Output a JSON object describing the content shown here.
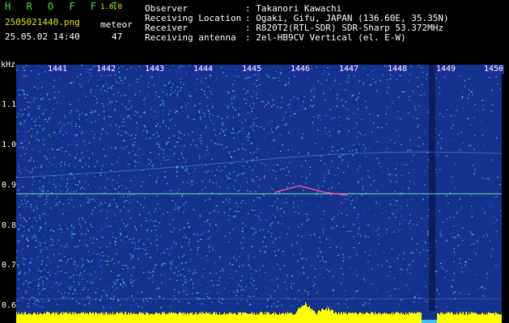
{
  "header": {
    "app_title": "H R O F F T",
    "app_version": "1.0.0",
    "file_name": "2505021440.png",
    "timestamp": "25.05.02 14:40",
    "meteor_label": "meteor",
    "meteor_count": "47"
  },
  "station_info": [
    {
      "label": "Observer",
      "value": ": Takanori Kawachi"
    },
    {
      "label": "Receiving Location",
      "value": ": Ogaki, Gifu, JAPAN (136.60E, 35.35N)"
    },
    {
      "label": "Receiver",
      "value": ": R820T2(RTL-SDR) SDR-Sharp 53.372MHz"
    },
    {
      "label": "Receiving antenna",
      "value": ": 2el-HB9CV Vertical (el. E-W)"
    }
  ],
  "spectrogram": {
    "freq_unit": "kHz",
    "freq_ticks": [
      "1.1",
      "1.0",
      "0.9",
      "0.8",
      "0.7",
      "0.6"
    ],
    "time_ticks": [
      "1441",
      "1442",
      "1443",
      "1444",
      "1445",
      "1446",
      "1447",
      "1448",
      "1449",
      "1450"
    ],
    "colors": {
      "background": "#14318c",
      "noise_high": "#3fa8ff",
      "carrier_line": "#7cf0c8",
      "meteor_trace": "#ff4fa0",
      "level_bar": "#ffff00"
    }
  }
}
